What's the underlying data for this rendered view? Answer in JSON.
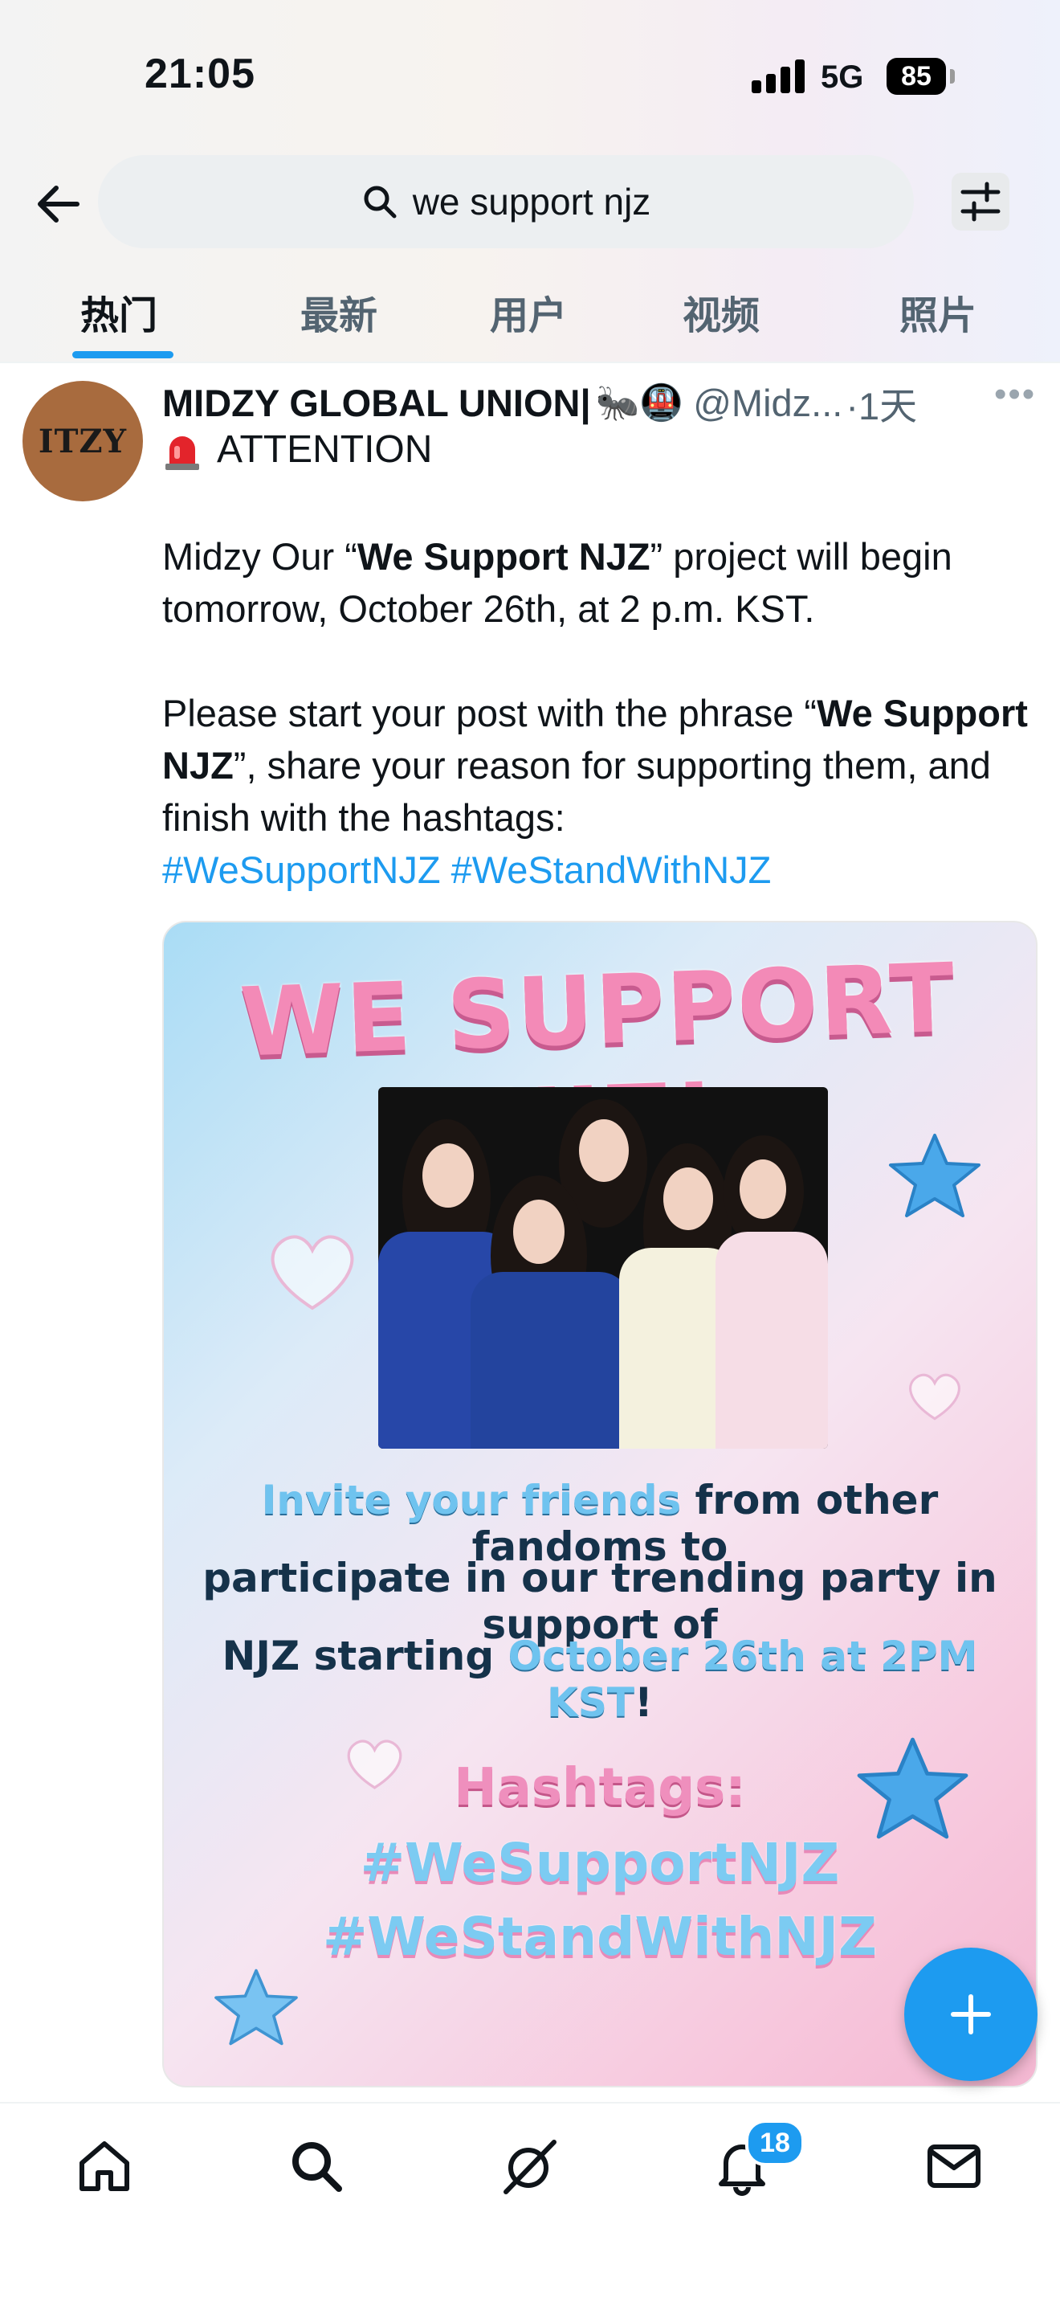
{
  "status_bar": {
    "time": "21:05",
    "network": "5G",
    "battery": "85"
  },
  "search": {
    "query": "we support njz"
  },
  "tabs": [
    {
      "label": "热门",
      "active": true
    },
    {
      "label": "最新"
    },
    {
      "label": "用户"
    },
    {
      "label": "视频"
    },
    {
      "label": "照片"
    }
  ],
  "tweet": {
    "avatar_text": "ITZY",
    "author_name": "MIDZY GLOBAL UNION|",
    "author_emoji": "🐜🚇",
    "handle": "@Midz...",
    "time": "·1天",
    "attention": "ATTENTION",
    "para1_pre": "Midzy Our “",
    "para1_bold": "We Support NJZ",
    "para1_post": "” project will begin tomorrow, October 26th, at 2 p.m. KST.",
    "para2_pre": "Please start your post with the phrase “",
    "para2_bold": "We Support NJZ",
    "para2_post": "”, share your reason for supporting them, and finish with the hashtags:",
    "hashtag1": "#WeSupportNJZ",
    "hashtag2": "#WeStandWithNJZ"
  },
  "poster": {
    "title": "WE SUPPORT NJZ!",
    "line1_hl": "Invite your friends",
    "line1_rest": " from other fandoms to",
    "line2": "participate in our trending party in support of",
    "line3_pre": "NJZ starting ",
    "line3_hl": "October 26th at 2PM KST",
    "line3_post": "!",
    "hashtags_title": "Hashtags:",
    "hashtag1": "#WeSupportNJZ",
    "hashtag2": "#WeStandWithNJZ"
  },
  "bottom_nav": {
    "notifications_badge": "18"
  },
  "colors": {
    "accent": "#1d9bf0",
    "text": "#0f1419",
    "muted": "#536471"
  }
}
